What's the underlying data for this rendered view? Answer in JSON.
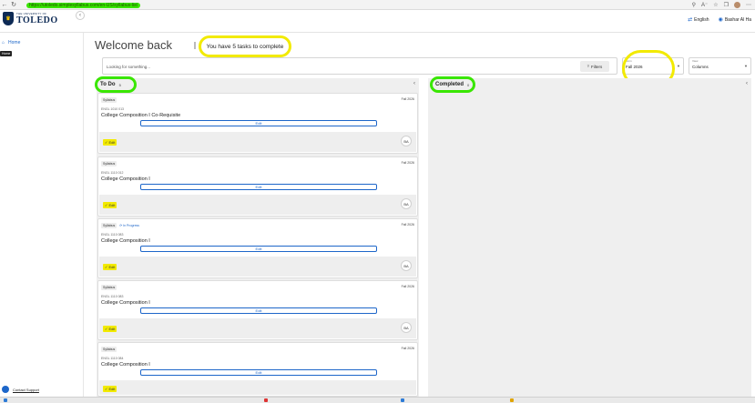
{
  "browser": {
    "url": "https://utoledo.simplesyllabus.com/en-US/syllabus-list",
    "icons": [
      "back-icon",
      "refresh-icon",
      "zoom-icon",
      "read-aloud-icon",
      "favorite-icon",
      "collections-icon",
      "more-icon"
    ]
  },
  "header": {
    "logo_small": "THE UNIVERSITY OF",
    "logo_main": "TOLEDO",
    "language": "English",
    "user_name": "Bashar Al Ha"
  },
  "sidebar": {
    "home_label": "Home",
    "tooltip": "Home",
    "contact_label": "Contact Support"
  },
  "main": {
    "welcome": "Welcome back",
    "tasks_text": "You have 5 tasks to complete",
    "search_placeholder": "Looking for something...",
    "filters_label": "Filters",
    "term": {
      "label": "Term",
      "value": "Fall 2026"
    },
    "view": {
      "label": "View",
      "value": "Columns"
    }
  },
  "columns": {
    "todo": {
      "title": "To Do",
      "count": "5"
    },
    "completed": {
      "title": "Completed",
      "count": "0"
    }
  },
  "cards": [
    {
      "tag": "Syllabus",
      "progress": "",
      "term": "Fall 2026",
      "code": "ENGL 1010 013",
      "title": "College Composition I Co-Requisite",
      "edit": "Edit",
      "status": "Edit",
      "initials": "BA"
    },
    {
      "tag": "Syllabus",
      "progress": "",
      "term": "Fall 2026",
      "code": "ENGL 1110 012",
      "title": "College Composition I",
      "edit": "Edit",
      "status": "Edit",
      "initials": "BA"
    },
    {
      "tag": "Syllabus",
      "progress": "In Progress",
      "term": "Fall 2026",
      "code": "ENGL 1110 083",
      "title": "College Composition I",
      "edit": "Edit",
      "status": "Edit",
      "initials": "BA"
    },
    {
      "tag": "Syllabus",
      "progress": "",
      "term": "Fall 2026",
      "code": "ENGL 1110 083",
      "title": "College Composition I",
      "edit": "Edit",
      "status": "Edit",
      "initials": "BA"
    },
    {
      "tag": "Syllabus",
      "progress": "",
      "term": "Fall 2026",
      "code": "ENGL 1110 084",
      "title": "College Composition I",
      "edit": "Edit",
      "status": "Edit",
      "initials": "BA"
    }
  ],
  "colors": {
    "highlight_yellow": "#f2ea00",
    "highlight_green": "#39e600",
    "accent_blue": "#1d66c9",
    "brand_navy": "#0d2a55"
  }
}
